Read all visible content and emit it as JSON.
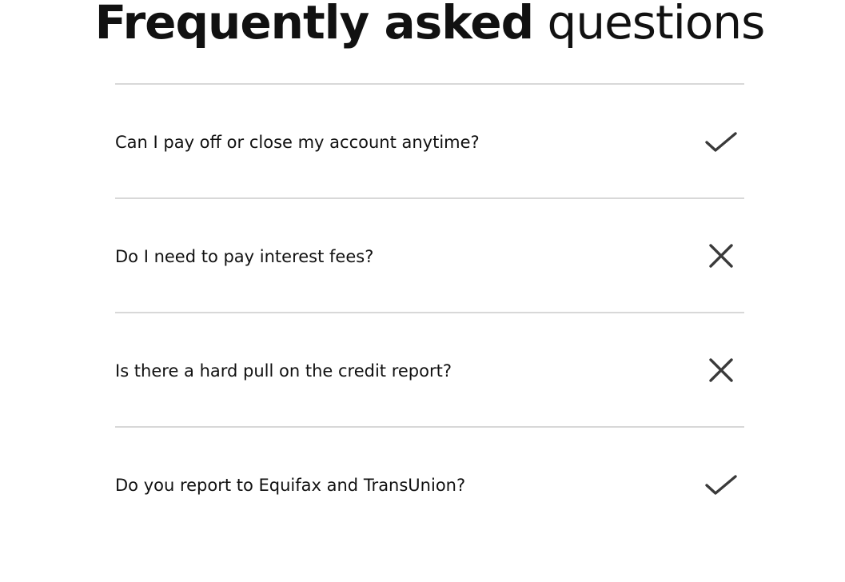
{
  "header": {
    "title_bold": "Frequently asked",
    "title_light": " questions"
  },
  "faq": {
    "items": [
      {
        "question": "Can I pay off or close my account anytime?",
        "answer_icon": "check-icon"
      },
      {
        "question": "Do I need to pay interest fees?",
        "answer_icon": "close-icon"
      },
      {
        "question": "Is there a hard pull on the credit report?",
        "answer_icon": "close-icon"
      },
      {
        "question": "Do you report to Equifax and TransUnion?",
        "answer_icon": "check-icon"
      }
    ]
  },
  "colors": {
    "text": "#111111",
    "icon": "#3a3a3a",
    "divider": "#d8d8d8",
    "background": "#ffffff"
  }
}
